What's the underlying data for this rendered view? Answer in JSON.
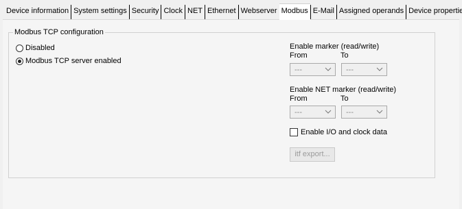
{
  "tabs": [
    {
      "label": "Device information",
      "active": false
    },
    {
      "label": "System settings",
      "active": false
    },
    {
      "label": "Security",
      "active": false
    },
    {
      "label": "Clock",
      "active": false
    },
    {
      "label": "NET",
      "active": false
    },
    {
      "label": "Ethernet",
      "active": false
    },
    {
      "label": "Webserver",
      "active": false
    },
    {
      "label": "Modbus",
      "active": true
    },
    {
      "label": "E-Mail",
      "active": false
    },
    {
      "label": "Assigned operands",
      "active": false
    },
    {
      "label": "Device properties",
      "active": false
    }
  ],
  "modbus": {
    "group_title": "Modbus TCP configuration",
    "mode_options": [
      {
        "label": "Disabled",
        "checked": false
      },
      {
        "label": "Modbus TCP server enabled",
        "checked": true
      }
    ],
    "marker": {
      "title": "Enable marker (read/write)",
      "from_label": "From",
      "to_label": "To",
      "from_value": "---",
      "to_value": "---"
    },
    "net_marker": {
      "title": "Enable NET marker (read/write)",
      "from_label": "From",
      "to_label": "To",
      "from_value": "---",
      "to_value": "---"
    },
    "io_clock_checkbox": {
      "label": "Enable I/O and clock data",
      "checked": false
    },
    "export_button": "itf export..."
  },
  "colors": {
    "panel_bg": "#f5f5f5",
    "disabled_text": "#8a8a8a"
  }
}
